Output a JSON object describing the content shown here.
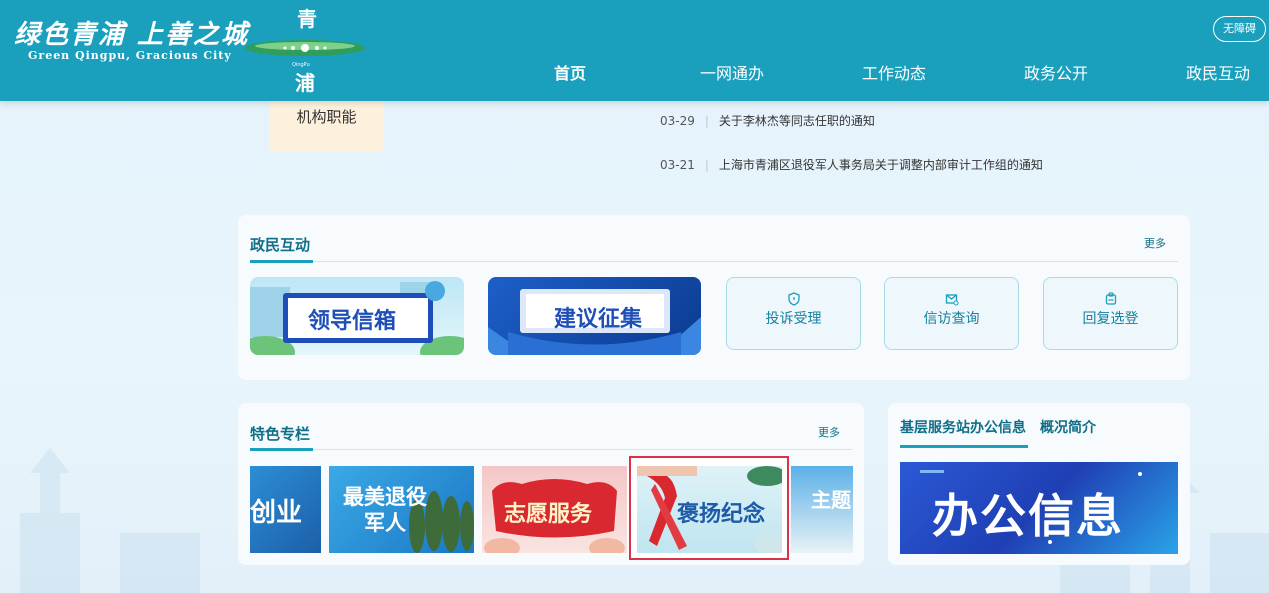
{
  "header": {
    "logo_cn": "绿色青浦 上善之城",
    "logo_en": "Green Qingpu, Gracious City",
    "emblem_top": "青",
    "emblem_small": "QingPu",
    "emblem_bottom": "浦",
    "accessibility_label": "无障碍",
    "nav": [
      "首页",
      "一网通办",
      "工作动态",
      "政务公开",
      "政民互动"
    ]
  },
  "top": {
    "org_card_label": "机构职能",
    "notices": [
      {
        "date": "03-29",
        "title": "关于李林杰等同志任职的通知"
      },
      {
        "date": "03-21",
        "title": "上海市青浦区退役军人事务局关于调整内部审计工作组的通知"
      }
    ]
  },
  "interaction": {
    "title": "政民互动",
    "more": "更多",
    "banners": [
      {
        "label": "领导信箱"
      },
      {
        "label": "建议征集"
      }
    ],
    "services": [
      {
        "label": "投诉受理",
        "icon": "shield-icon"
      },
      {
        "label": "信访查询",
        "icon": "mail-search-icon"
      },
      {
        "label": "回复选登",
        "icon": "clipboard-icon"
      }
    ]
  },
  "featured": {
    "title": "特色专栏",
    "more": "更多",
    "tiles": [
      {
        "label": "创业"
      },
      {
        "label": "最美退役军人"
      },
      {
        "label": "志愿服务"
      },
      {
        "label": "褒扬纪念"
      },
      {
        "label": "主题"
      }
    ]
  },
  "station": {
    "tabs": [
      "基层服务站办公信息",
      "概况简介"
    ],
    "banner_label": "办公信息"
  },
  "colors": {
    "header": "#1a9fbd",
    "accent": "#0f6f86",
    "highlight_border": "#d9334a"
  }
}
